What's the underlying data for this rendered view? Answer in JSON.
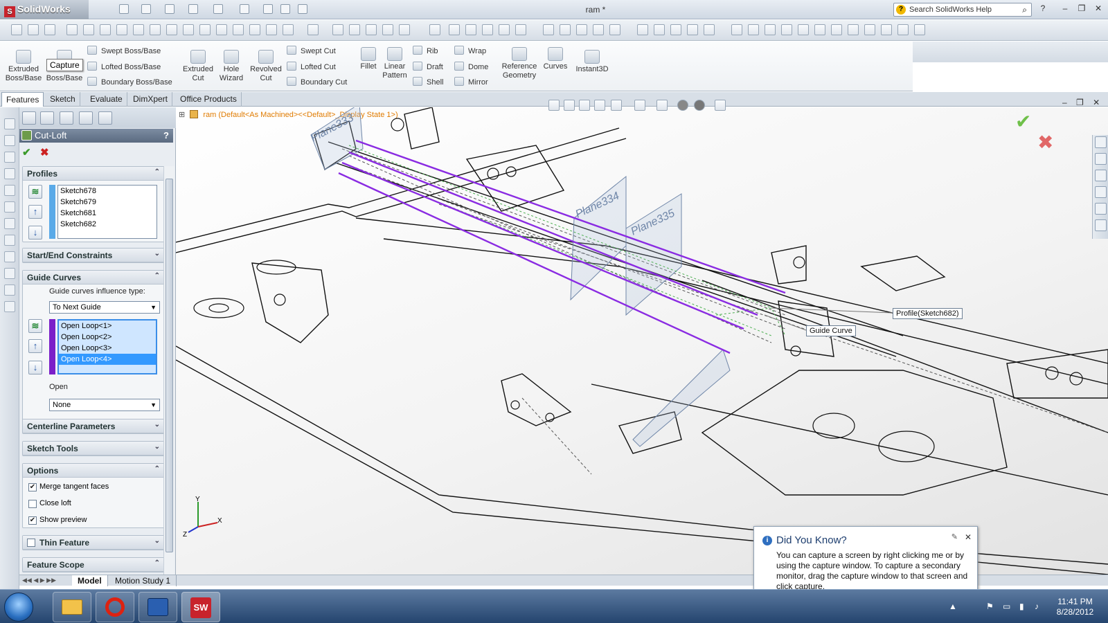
{
  "app": {
    "name": "SolidWorks",
    "doc_title": "ram *",
    "search_placeholder": "Search SolidWorks Help"
  },
  "ribbon": {
    "extruded_boss": "Extruded\nBoss/Base",
    "revolved_boss": "Revolved\nBoss/Base",
    "swept_boss": "Swept Boss/Base",
    "lofted_boss": "Lofted Boss/Base",
    "boundary_boss": "Boundary Boss/Base",
    "extruded_cut": "Extruded\nCut",
    "hole_wizard": "Hole\nWizard",
    "revolved_cut": "Revolved\nCut",
    "swept_cut": "Swept Cut",
    "lofted_cut": "Lofted Cut",
    "boundary_cut": "Boundary Cut",
    "fillet": "Fillet",
    "linear_pattern": "Linear\nPattern",
    "rib": "Rib",
    "draft": "Draft",
    "shell": "Shell",
    "wrap": "Wrap",
    "dome": "Dome",
    "mirror": "Mirror",
    "reference_geometry": "Reference\nGeometry",
    "curves": "Curves",
    "instant3d": "Instant3D",
    "tooltip": "Capture"
  },
  "tabs": [
    "Features",
    "Sketch",
    "Evaluate",
    "DimXpert",
    "Office Products"
  ],
  "active_tab": "Features",
  "property_manager": {
    "title": "Cut-Loft",
    "help": "?",
    "profiles": {
      "label": "Profiles",
      "items": [
        "Sketch678",
        "Sketch679",
        "Sketch681",
        "Sketch682"
      ]
    },
    "start_end": {
      "label": "Start/End Constraints"
    },
    "guide_curves": {
      "label": "Guide Curves",
      "influence_label": "Guide curves influence type:",
      "influence_value": "To Next Guide",
      "items": [
        "Open Loop<1>",
        "Open Loop<2>",
        "Open Loop<3>",
        "Open Loop<4>"
      ],
      "selected_index": 3,
      "open_label": "Open",
      "open_value": "None"
    },
    "centerline": {
      "label": "Centerline Parameters"
    },
    "sketch_tools": {
      "label": "Sketch Tools"
    },
    "options": {
      "label": "Options",
      "merge_tangent": {
        "label": "Merge tangent faces",
        "checked": true
      },
      "close_loft": {
        "label": "Close loft",
        "checked": false
      },
      "show_preview": {
        "label": "Show preview",
        "checked": true
      }
    },
    "thin_feature": {
      "label": "Thin Feature",
      "checked": false
    },
    "feature_scope": {
      "label": "Feature Scope"
    }
  },
  "viewport": {
    "tree_path": "ram  (Default<As Machined><<Default>_Display State 1>)",
    "planes": [
      "Plane333",
      "Plane334",
      "Plane335"
    ],
    "callouts": {
      "profile": "Profile(Sketch682)",
      "guide": "Guide Curve"
    },
    "triad": {
      "x": "X",
      "y": "Y",
      "z": "Z"
    }
  },
  "bottom_tabs": [
    "Model",
    "Motion Study 1"
  ],
  "did_you_know": {
    "title": "Did You Know?",
    "body": "You can capture a screen by right clicking me or by using the capture window. To capture a secondary monitor, drag the capture window to that screen and click capture."
  },
  "taskbar": {
    "time": "11:41 PM",
    "date": "8/28/2012"
  },
  "colors": {
    "guide": "#8a2be2",
    "profile_bar": "#5aaae8",
    "guide_bar": "#7b1fc9",
    "ok": "#3a9a2a",
    "cancel": "#cc2222"
  }
}
